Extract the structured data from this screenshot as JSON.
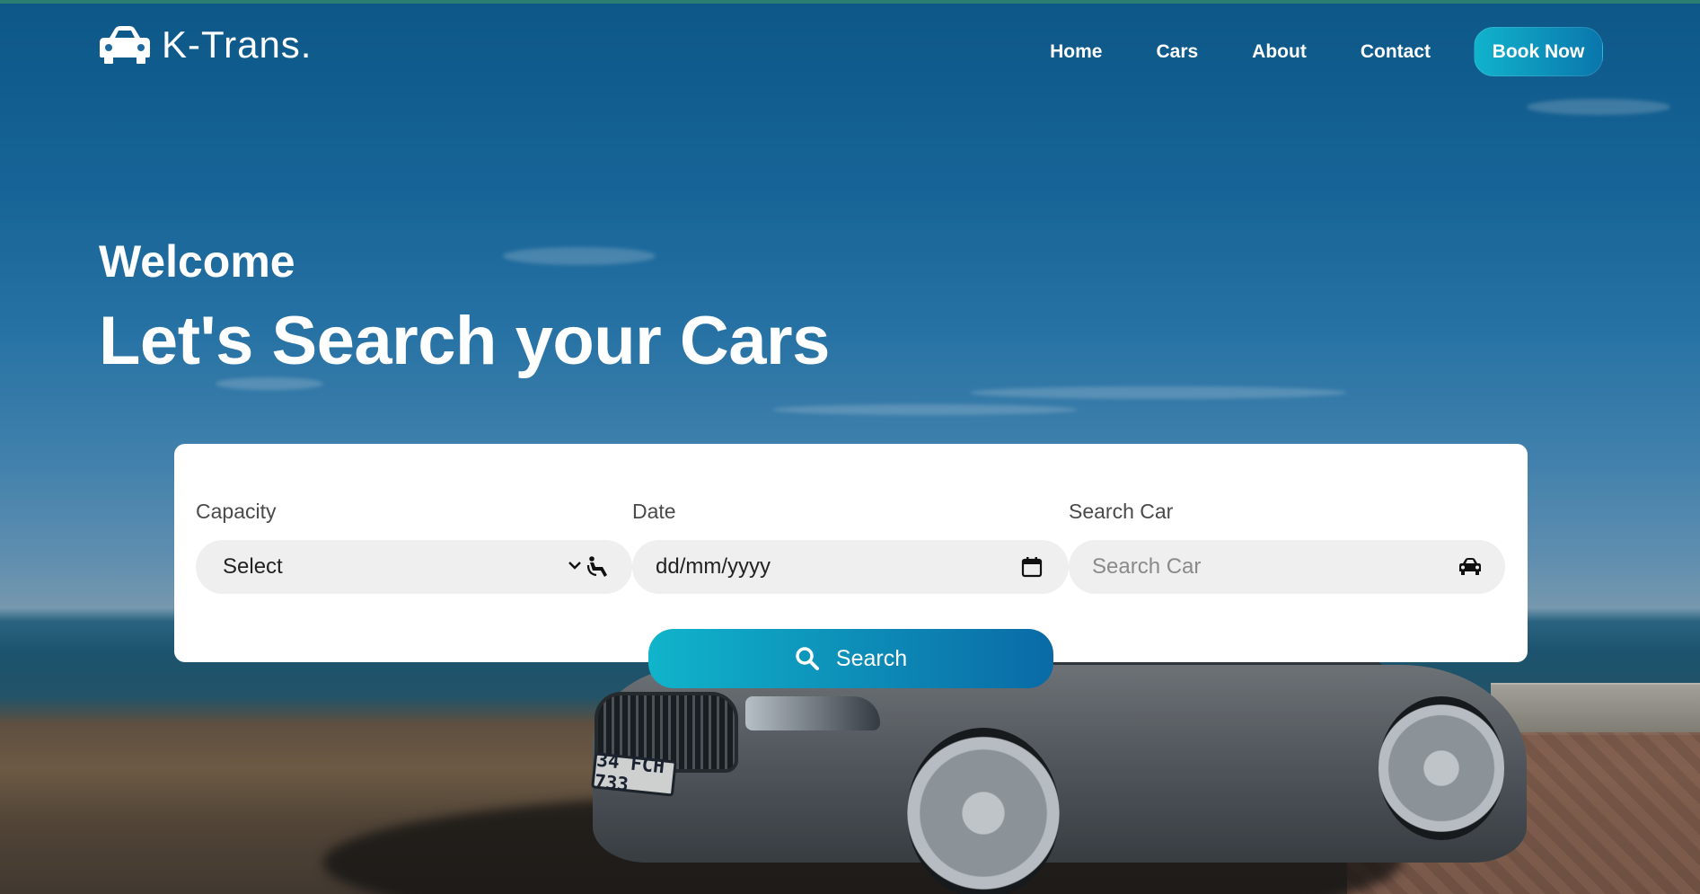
{
  "brand": {
    "name": "K-Trans.",
    "icon": "car-icon"
  },
  "nav": {
    "links": [
      "Home",
      "Cars",
      "About",
      "Contact"
    ],
    "cta": "Book Now"
  },
  "hero": {
    "welcome": "Welcome",
    "headline": "Let's Search your Cars",
    "plate": "34 FCH 733"
  },
  "search": {
    "capacity": {
      "label": "Capacity",
      "value": "Select",
      "icon": "seat-icon"
    },
    "date": {
      "label": "Date",
      "value": "dd/mm/yyyy",
      "icon": "calendar-icon"
    },
    "car": {
      "label": "Search Car",
      "placeholder": "Search Car",
      "icon": "car-icon"
    },
    "button": "Search"
  },
  "colors": {
    "accent_start": "#10b4cb",
    "accent_end": "#0a6aa6",
    "text_white": "#ffffff"
  }
}
